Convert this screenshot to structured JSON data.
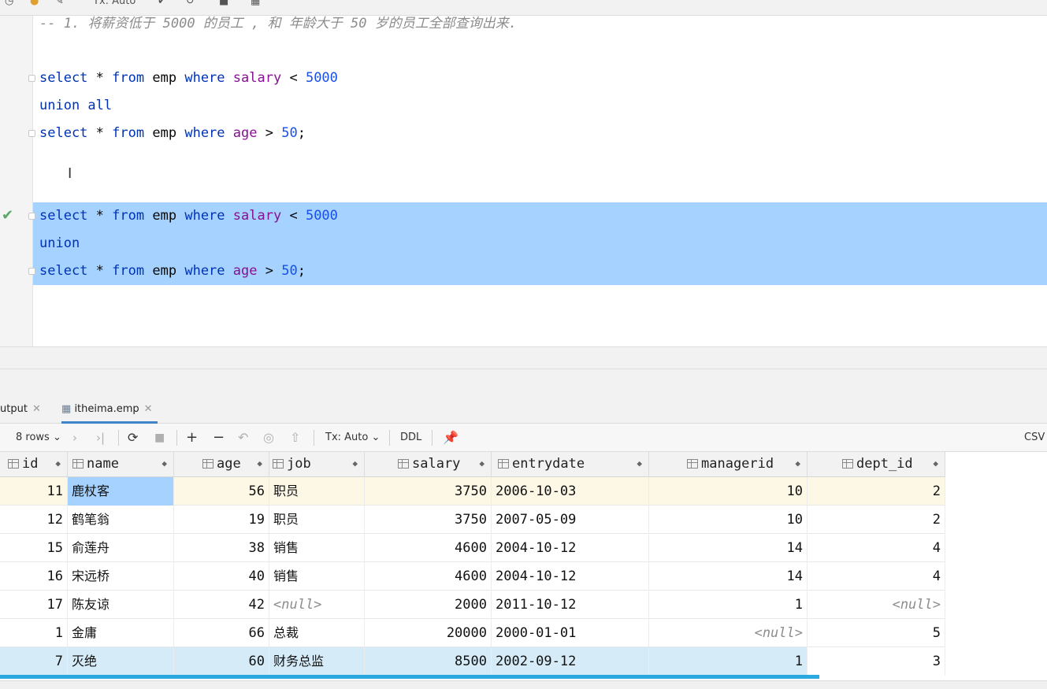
{
  "toolbar": {
    "tx_label": "Tx: Auto"
  },
  "editor": {
    "comment": "-- 1. 将薪资低于 5000 的员工 , 和 年龄大于 50 岁的员工全部查询出来.",
    "q1": {
      "l1": {
        "kw1": "select",
        "star": "*",
        "kw2": "from",
        "tbl": "emp",
        "kw3": "where",
        "col": "salary",
        "op": "<",
        "val": "5000"
      },
      "l2": "union all",
      "l3": {
        "kw1": "select",
        "star": "*",
        "kw2": "from",
        "tbl": "emp",
        "kw3": "where",
        "col": "age",
        "op": ">",
        "val": "50",
        "end": ";"
      }
    },
    "q2": {
      "l1": {
        "kw1": "select",
        "star": "*",
        "kw2": "from",
        "tbl": "emp",
        "kw3": "where",
        "col": "salary",
        "op": "<",
        "val": "5000"
      },
      "l2": "union",
      "l3": {
        "kw1": "select",
        "star": "*",
        "kw2": "from",
        "tbl": "emp",
        "kw3": "where",
        "col": "age",
        "op": ">",
        "val": "50",
        "end": ";"
      }
    }
  },
  "tabs": {
    "output": "utput",
    "emp": "itheima.emp"
  },
  "results_toolbar": {
    "rows": "8 rows",
    "tx": "Tx: Auto",
    "ddl": "DDL",
    "csv": "CSV"
  },
  "columns": [
    "id",
    "name",
    "age",
    "job",
    "salary",
    "entrydate",
    "managerid",
    "dept_id"
  ],
  "rows": [
    {
      "id": "11",
      "name": "鹿杖客",
      "age": "56",
      "job": "职员",
      "salary": "3750",
      "entrydate": "2006-10-03",
      "managerid": "10",
      "dept_id": "2"
    },
    {
      "id": "12",
      "name": "鹤笔翁",
      "age": "19",
      "job": "职员",
      "salary": "3750",
      "entrydate": "2007-05-09",
      "managerid": "10",
      "dept_id": "2"
    },
    {
      "id": "15",
      "name": "俞莲舟",
      "age": "38",
      "job": "销售",
      "salary": "4600",
      "entrydate": "2004-10-12",
      "managerid": "14",
      "dept_id": "4"
    },
    {
      "id": "16",
      "name": "宋远桥",
      "age": "40",
      "job": "销售",
      "salary": "4600",
      "entrydate": "2004-10-12",
      "managerid": "14",
      "dept_id": "4"
    },
    {
      "id": "17",
      "name": "陈友谅",
      "age": "42",
      "job": "<null>",
      "salary": "2000",
      "entrydate": "2011-10-12",
      "managerid": "1",
      "dept_id": "<null>"
    },
    {
      "id": "1",
      "name": "金庸",
      "age": "66",
      "job": "总裁",
      "salary": "20000",
      "entrydate": "2000-01-01",
      "managerid": "<null>",
      "dept_id": "5"
    },
    {
      "id": "7",
      "name": "灭绝",
      "age": "60",
      "job": "财务总监",
      "salary": "8500",
      "entrydate": "2002-09-12",
      "managerid": "1",
      "dept_id": "3"
    }
  ]
}
